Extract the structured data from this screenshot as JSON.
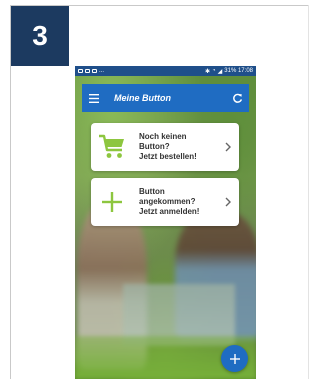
{
  "step": {
    "number": "3"
  },
  "status_bar": {
    "left_icons": [
      "image-icon",
      "mail-icon",
      "android-icon"
    ],
    "left_text": "...",
    "right_text": "31% 17:08",
    "right_icons": [
      "bluetooth-icon",
      "wifi-icon",
      "signal-icon",
      "battery-icon"
    ]
  },
  "app_bar": {
    "title": "Meine Button",
    "menu_icon": "hamburger-icon",
    "refresh_icon": "refresh-icon"
  },
  "cards": [
    {
      "lines": [
        "Noch keinen",
        "Button?",
        "Jetzt bestellen!"
      ],
      "icon": "cart-icon"
    },
    {
      "lines": [
        "Button",
        "angekommen?",
        "Jetzt anmelden!"
      ],
      "icon": "plus-icon"
    }
  ],
  "fab": {
    "icon": "plus-icon"
  },
  "colors": {
    "badge": "#1c3a60",
    "app_bar": "#1f6cc2",
    "status_bar": "#1f4f8a",
    "accent_green": "#8dc63f",
    "card_text": "#333333"
  }
}
